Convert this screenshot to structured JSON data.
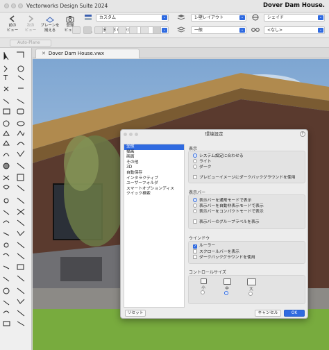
{
  "app": {
    "name": "Vectorworks Design Suite 2024",
    "document_title": "Dover Dam House."
  },
  "toolbar": {
    "back_label": "前の\nビュー",
    "forward_label": "次の\nビュー",
    "plane_label": "プレーンを\n揃える",
    "register_view_label": "登録\nビュー",
    "class_select": "カスタム",
    "projection_select": "投影投影 (標準)",
    "layer_select": "1-壁レイアウト",
    "layer2_select": "一般",
    "render_select": "シェイド",
    "viewpoint_select": "<なし>"
  },
  "row2": {
    "autoplane_label": "Auto-Plane"
  },
  "tab": {
    "title": "Dover Dam House.vwx"
  },
  "dialog": {
    "title": "環境設定",
    "help": "?",
    "categories": [
      "全般",
      "描画",
      "画面",
      "その他",
      "3D",
      "自動保存",
      "インタラクティブ",
      "ユーザーフォルダ",
      "スマートオプションディス",
      "クイック検索"
    ],
    "selected_category_index": 0,
    "display_section": {
      "title": "表示",
      "radio_options": [
        "システム設定に合わせる",
        "ライト",
        "ダーク"
      ],
      "selected_radio": 0,
      "preview_check_label": "プレビューイメージにダークバックグラウンドを使用",
      "preview_checked": false
    },
    "statusbar_section": {
      "title": "表示バー",
      "radio_options": [
        "表示バーを通常モードで表示",
        "表示バーを自動非表示モードで表示",
        "表示バーをコンパクトモードで表示"
      ],
      "selected_radio": 0,
      "group_label_check": "表示バーのグループラベルを表示",
      "group_label_checked": false
    },
    "window_section": {
      "title": "ウインドウ",
      "checks": [
        {
          "label": "ルーラー",
          "checked": true
        },
        {
          "label": "スクロールバーを表示",
          "checked": false
        },
        {
          "label": "ダークバックグラウンドを使用",
          "checked": false
        }
      ]
    },
    "control_size_section": {
      "title": "コントロールサイズ",
      "sizes": [
        "小",
        "中",
        "大"
      ],
      "selected_size": 1
    },
    "reset_label": "リセット",
    "cancel_label": "キャンセル",
    "ok_label": "OK"
  },
  "colors": {
    "accent": "#2f6ae0",
    "sky": "#8fb1d4",
    "roof_wood": "#b08a4e",
    "wall_brick": "#5a3a2e",
    "concrete": "#6f6f73",
    "grass": "#78ab3e"
  }
}
